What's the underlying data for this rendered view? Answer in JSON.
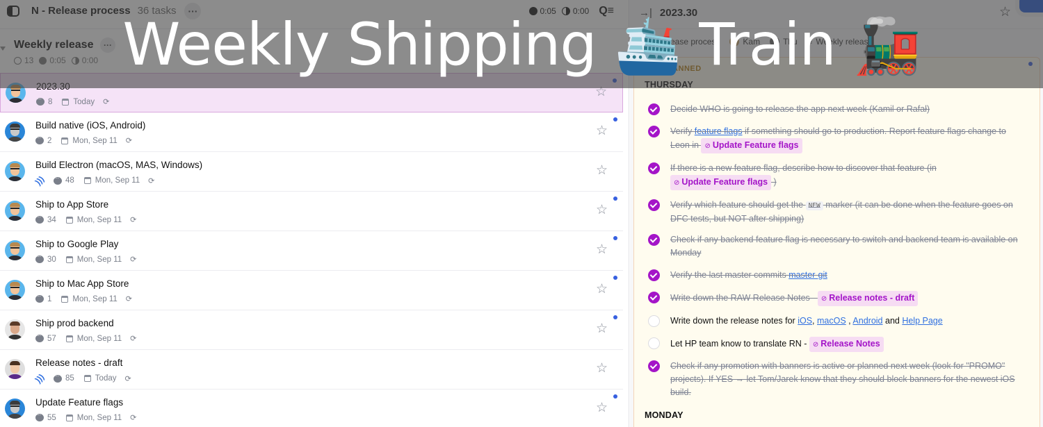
{
  "header": {
    "project_title": "N - Release process",
    "task_count": "36 tasks",
    "more_label": "···",
    "time_tracked": "0:05",
    "time_estimated": "0:00"
  },
  "section": {
    "title": "Weekly release",
    "more_label": "···",
    "open_count": "13",
    "time_tracked": "0:05",
    "time_estimated": "0:00"
  },
  "tasks": [
    {
      "title": "2023.30",
      "comments": "8",
      "due": "Today",
      "rss": false,
      "unread": true,
      "avatar": "cartoon",
      "selected": true
    },
    {
      "title": "Build native (iOS, Android)",
      "comments": "2",
      "due": "Mon, Sep 11",
      "rss": false,
      "unread": true,
      "avatar": "photo-blue"
    },
    {
      "title": "Build Electron (macOS, MAS, Windows)",
      "comments": "48",
      "due": "Mon, Sep 11",
      "rss": true,
      "unread": false,
      "avatar": "cartoon"
    },
    {
      "title": "Ship to App Store",
      "comments": "34",
      "due": "Mon, Sep 11",
      "rss": false,
      "unread": true,
      "avatar": "cartoon"
    },
    {
      "title": "Ship to Google Play",
      "comments": "30",
      "due": "Mon, Sep 11",
      "rss": false,
      "unread": true,
      "avatar": "cartoon"
    },
    {
      "title": "Ship to Mac App Store",
      "comments": "1",
      "due": "Mon, Sep 11",
      "rss": false,
      "unread": true,
      "avatar": "cartoon"
    },
    {
      "title": "Ship prod backend",
      "comments": "57",
      "due": "Mon, Sep 11",
      "rss": false,
      "unread": true,
      "avatar": "photo-man"
    },
    {
      "title": "Release notes - draft",
      "comments": "85",
      "due": "Today",
      "rss": true,
      "unread": false,
      "avatar": "photo-purple"
    },
    {
      "title": "Update Feature flags",
      "comments": "55",
      "due": "Mon, Sep 11",
      "rss": false,
      "unread": true,
      "avatar": "photo-blue"
    }
  ],
  "detail": {
    "title": "2023.30",
    "chips": [
      "Release process",
      "Kam",
      "Thu",
      "Weekly release"
    ],
    "note_label": "PLANNED",
    "days": [
      "THURSDAY",
      "MONDAY"
    ],
    "items": {
      "i1": {
        "text": "Decide WHO is going to release the app next week (Kamil or Rafał)",
        "done": true
      },
      "i2": {
        "pre": "Verify ",
        "link": "feature flags",
        "mid": " if something should go to production. Report feature flags change to Leon in ",
        "mention": "Update Feature flags",
        "done": true
      },
      "i3": {
        "pre": "If there is a new feature flag, describe how to discover that feature (in ",
        "mention": "Update Feature flags",
        "post": " )",
        "done": true
      },
      "i4": {
        "pre": "Verify which feature should get the ",
        "code": "NEW",
        "post": " marker (it can be done when the feature goes on DFC tests, but NOT after shipping)",
        "done": true
      },
      "i5": {
        "text": "Check if any backend feature flag is necessary to switch and backend team is available on Monday",
        "done": true
      },
      "i6": {
        "pre": "Verify the last master commits ",
        "link": "master-git",
        "done": true
      },
      "i7": {
        "pre": "Write down the RAW Release Notes - ",
        "mention": "Release notes - draft",
        "done": true
      },
      "i8": {
        "pre": "Write down the release notes for ",
        "links": [
          "iOS",
          "macOS",
          "Android",
          "Help Page"
        ],
        "sep1": ", ",
        "sep2": " , ",
        "sep3": " and ",
        "done": false
      },
      "i9": {
        "pre": "Let HP team know to translate RN - ",
        "mention": "Release Notes",
        "done": false
      },
      "i10": {
        "text": "Check if any promotion with banners is active or planned next week (look for \"PROMO\" projects). If YES → let Tom/Jarek know that they should block banners for the newest iOS build.",
        "done": true
      }
    }
  },
  "banner": {
    "text1": "Weekly Shipping ",
    "ship_emoji": "🛳️",
    "text2": " Train ",
    "train_emoji": "🚂"
  },
  "icons": {
    "star": "☆",
    "repeat": "⟳",
    "rss": ")))",
    "mention_check": "⊘",
    "collapse_panel": "→|",
    "search_filter": "Q≡"
  }
}
